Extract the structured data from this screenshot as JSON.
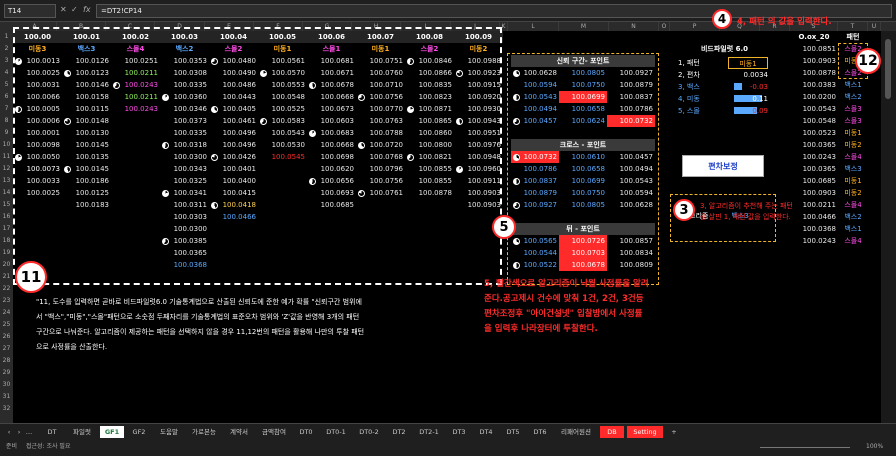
{
  "formula_bar": {
    "cell_ref": "T14",
    "fx": "fx",
    "formula": "=DT2!CP14"
  },
  "columns": [
    "A",
    "B",
    "C",
    "D",
    "E",
    "F",
    "G",
    "H",
    "I",
    "J",
    "K",
    "L",
    "M",
    "N",
    "O",
    "P",
    "Q",
    "R",
    "S",
    "T",
    "U"
  ],
  "row_numbers": [
    "1",
    "2",
    "3",
    "4",
    "5",
    "6",
    "7",
    "8",
    "9",
    "10",
    "11",
    "12",
    "13",
    "14",
    "15",
    "16",
    "17",
    "18",
    "19",
    "20",
    "21",
    "22",
    "23",
    "24",
    "25",
    "26",
    "27",
    "28",
    "29",
    "30",
    "31",
    "32"
  ],
  "main_table": {
    "headers": [
      "100.00",
      "100.01",
      "100.02",
      "100.03",
      "100.04",
      "100.05",
      "100.06",
      "100.07",
      "100.08",
      "100.09"
    ],
    "pattern_labels": [
      "미동3",
      "백스3",
      "스몰4",
      "백스2",
      "스몰2",
      "미동1",
      "스몰1",
      "미동1",
      "스몰2",
      "미동2"
    ],
    "rows": [
      [
        "100.0013",
        "100.0126",
        "100.0251",
        "100.0353",
        "100.0480",
        "100.0561",
        "100.0681",
        "100.0751",
        "100.0846",
        "100.0988"
      ],
      [
        "100.0025",
        "100.0123",
        "100.0211",
        "100.0308",
        "100.0490",
        "100.0570",
        "100.0671",
        "100.0760",
        "100.0866",
        "100.0923"
      ],
      [
        "100.0031",
        "100.0146",
        "100.0243",
        "100.0335",
        "100.0486",
        "100.0553",
        "100.0678",
        "100.0710",
        "100.0835",
        "100.0915"
      ],
      [
        "100.0066",
        "100.0158",
        "100.0211",
        "100.0360",
        "100.0443",
        "100.0548",
        "100.0668",
        "100.0756",
        "100.0823",
        "100.0920"
      ],
      [
        "100.0005",
        "100.0115",
        "100.0243",
        "100.0346",
        "100.0405",
        "100.0525",
        "100.0673",
        "100.0770",
        "100.0871",
        "100.0930"
      ],
      [
        "100.0006",
        "100.0148",
        "",
        "100.0373",
        "100.0461",
        "100.0583",
        "100.0603",
        "100.0763",
        "100.0865",
        "100.0943"
      ],
      [
        "100.0001",
        "100.0130",
        "",
        "100.0335",
        "100.0496",
        "100.0543",
        "100.0683",
        "100.0788",
        "100.0860",
        "100.0951"
      ],
      [
        "100.0098",
        "100.0145",
        "",
        "100.0318",
        "100.0496",
        "100.0530",
        "100.0668",
        "100.0720",
        "100.0800",
        "100.0976"
      ],
      [
        "100.0050",
        "100.0135",
        "",
        "100.0300",
        "100.0426",
        "100.0545",
        "100.0698",
        "100.0768",
        "100.0821",
        "100.0948"
      ],
      [
        "100.0073",
        "100.0145",
        "",
        "100.0343",
        "100.0401",
        "",
        "100.0620",
        "100.0796",
        "100.0855",
        "100.0960"
      ],
      [
        "100.0033",
        "100.0186",
        "",
        "100.0325",
        "100.0400",
        "",
        "100.0656",
        "100.0756",
        "100.0855",
        "100.0911"
      ],
      [
        "100.0025",
        "100.0125",
        "",
        "100.0341",
        "100.0415",
        "",
        "100.0693",
        "100.0761",
        "100.0878",
        "100.0903"
      ],
      [
        "",
        "100.0183",
        "",
        "100.0311",
        "100.0418",
        "",
        "100.0685",
        "",
        "",
        "100.0903"
      ],
      [
        "",
        "",
        "",
        "100.0303",
        "100.0466",
        "",
        "",
        "",
        "",
        ""
      ],
      [
        "",
        "",
        "",
        "100.0300",
        "",
        "",
        "",
        "",
        "",
        ""
      ],
      [
        "",
        "",
        "",
        "100.0385",
        "",
        "",
        "",
        "",
        "",
        ""
      ],
      [
        "",
        "",
        "",
        "100.0365",
        "",
        "",
        "",
        "",
        "",
        ""
      ],
      [
        "",
        "",
        "",
        "100.0368",
        "",
        "",
        "",
        "",
        "",
        ""
      ]
    ]
  },
  "panel_reliability": {
    "title": "신뢰 구간- 포인트",
    "rows": [
      [
        "100.0628",
        "100.0805",
        "100.0927"
      ],
      [
        "100.0594",
        "100.0750",
        "100.0879"
      ],
      [
        "100.0543",
        "100.0699",
        "100.0837"
      ],
      [
        "100.0494",
        "100.0658",
        "100.0786"
      ],
      [
        "100.0457",
        "100.0624",
        "100.0732"
      ]
    ]
  },
  "panel_cross": {
    "title": "크로스 - 포인트",
    "rows": [
      [
        "100.0732",
        "100.0610",
        "100.0457"
      ],
      [
        "100.0786",
        "100.0658",
        "100.0494"
      ],
      [
        "100.0837",
        "100.0699",
        "100.0543"
      ],
      [
        "100.0879",
        "100.0750",
        "100.0594"
      ],
      [
        "100.0927",
        "100.0805",
        "100.0628"
      ]
    ]
  },
  "panel_flip": {
    "title": "뒤 - 포인트",
    "rows": [
      [
        "100.0565",
        "100.0726",
        "100.0857"
      ],
      [
        "100.0544",
        "100.0703",
        "100.0834"
      ],
      [
        "100.0522",
        "100.0678",
        "100.0809"
      ]
    ]
  },
  "bidi": {
    "title": "비드파일럿 6.0",
    "rows": [
      {
        "label": "1, 패턴",
        "value": "미동1"
      },
      {
        "label": "2, 편차",
        "value": "0.0034"
      },
      {
        "label": "3, 백스",
        "value": "-0.03"
      },
      {
        "label": "4, 미동",
        "value": "0.11"
      },
      {
        "label": "5, 스몰",
        "value": "0.09"
      }
    ],
    "button": "편차보정",
    "algo_label": "6,알고리즘",
    "algo_value": "백스3"
  },
  "right_table": {
    "headers": [
      "O.ox_20",
      "패턴"
    ],
    "rows": [
      [
        "100.0851",
        "스몰2"
      ],
      [
        "100.0903",
        "미동1"
      ],
      [
        "100.0878",
        "스몰2"
      ],
      [
        "100.0383",
        "백스1"
      ],
      [
        "100.0200",
        "백스2"
      ],
      [
        "100.0543",
        "스몰3"
      ],
      [
        "100.0548",
        "스몰3"
      ],
      [
        "100.0523",
        "미동1"
      ],
      [
        "100.0365",
        "미동2"
      ],
      [
        "100.0243",
        "스몰4"
      ],
      [
        "100.0365",
        "백스3"
      ],
      [
        "100.0685",
        "미동1"
      ],
      [
        "100.0903",
        "미동2"
      ],
      [
        "100.0211",
        "스몰4"
      ],
      [
        "100.0466",
        "백스2"
      ],
      [
        "100.0368",
        "백스1"
      ],
      [
        "100.0243",
        "스몰4"
      ]
    ]
  },
  "annotations": {
    "b4_num": "4",
    "b4_text": "4, 패턴 의 값을 입력한다.",
    "b12_num": "12",
    "b3_num": "3",
    "b3_text": "3, 알고리즘이 추천해 주는 패턴을 살핀 1, 패턴 값을 입력한다.",
    "b5_num": "5",
    "b5_text": "5, 빨간색으로 알고리즘이 낙월 사정률을 알려준다.공고제시 건수에 맞춰 1건, 2건, 3건등 편차조정후 \"아이건설넷\" 입찰방에서 사정률을 입력후 나라장터에 투찰한다.",
    "b11_num": "11",
    "b11_text": "\"11, 도수를 입력하면 곧바로 비드파일럿6.0 기술통계법으로 산출된 신뢰도에 준한 예가 확률 \"신뢰구간 범위에서 \"백스\",\"미동\",\"스몰\"패턴으로 소숫점 두째자리를 기술통계법의 표준오차 범위와 'Z'값을 반영해 3개의 패턴 구간으로 나눠준다. 알고리즘이 제공하는 패턴을 선택하지 않을 경우 11,12번의 패턴을 활용해 나만의 투찰 패턴으로 사정률을 산출한다."
  },
  "sheet_tabs": [
    "DT",
    "파일럿",
    "GF1",
    "GF2",
    "도움말",
    "가로본능",
    "계약서",
    "금액참여",
    "DT0",
    "DT0-1",
    "DT0-2",
    "DT2",
    "DT2-1",
    "DT3",
    "DT4",
    "DT5",
    "DT6",
    "리패어원션",
    "DB",
    "Setting",
    "+"
  ],
  "active_tab": "GF1",
  "status": {
    "ready": "준비",
    "accessibility": "접근성: 조사 필요",
    "zoom": "100%"
  },
  "colors": {
    "accent_red": "#ff2b2b",
    "gold": "#f0b429",
    "blue": "#5aa9ff",
    "green": "#8df25a",
    "magenta": "#ff4ce8",
    "orange": "#ffb020"
  }
}
